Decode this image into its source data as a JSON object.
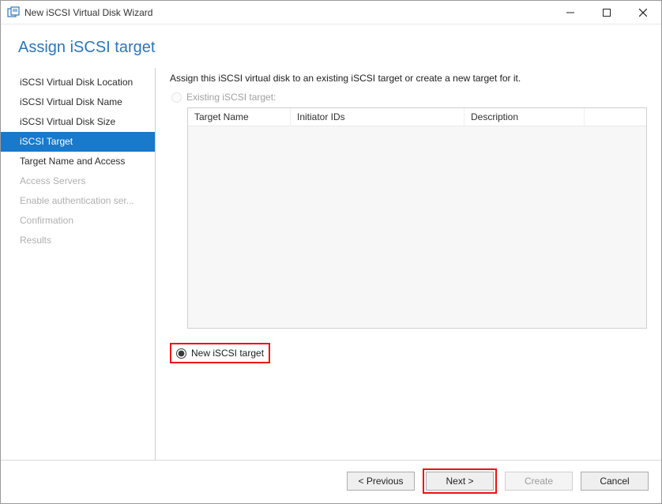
{
  "window": {
    "title": "New iSCSI Virtual Disk Wizard"
  },
  "header": {
    "title": "Assign iSCSI target"
  },
  "sidebar": {
    "items": [
      {
        "label": "iSCSI Virtual Disk Location",
        "state": "normal"
      },
      {
        "label": "iSCSI Virtual Disk Name",
        "state": "normal"
      },
      {
        "label": "iSCSI Virtual Disk Size",
        "state": "normal"
      },
      {
        "label": "iSCSI Target",
        "state": "active"
      },
      {
        "label": "Target Name and Access",
        "state": "normal"
      },
      {
        "label": "Access Servers",
        "state": "disabled"
      },
      {
        "label": "Enable authentication ser...",
        "state": "disabled"
      },
      {
        "label": "Confirmation",
        "state": "disabled"
      },
      {
        "label": "Results",
        "state": "disabled"
      }
    ]
  },
  "content": {
    "instruction": "Assign this iSCSI virtual disk to an existing iSCSI target or create a new target for it.",
    "radio_existing": "Existing iSCSI target:",
    "radio_new": "New iSCSI target",
    "table": {
      "columns": {
        "target_name": "Target Name",
        "initiator_ids": "Initiator IDs",
        "description": "Description"
      }
    }
  },
  "footer": {
    "previous": "< Previous",
    "next": "Next >",
    "create": "Create",
    "cancel": "Cancel"
  }
}
